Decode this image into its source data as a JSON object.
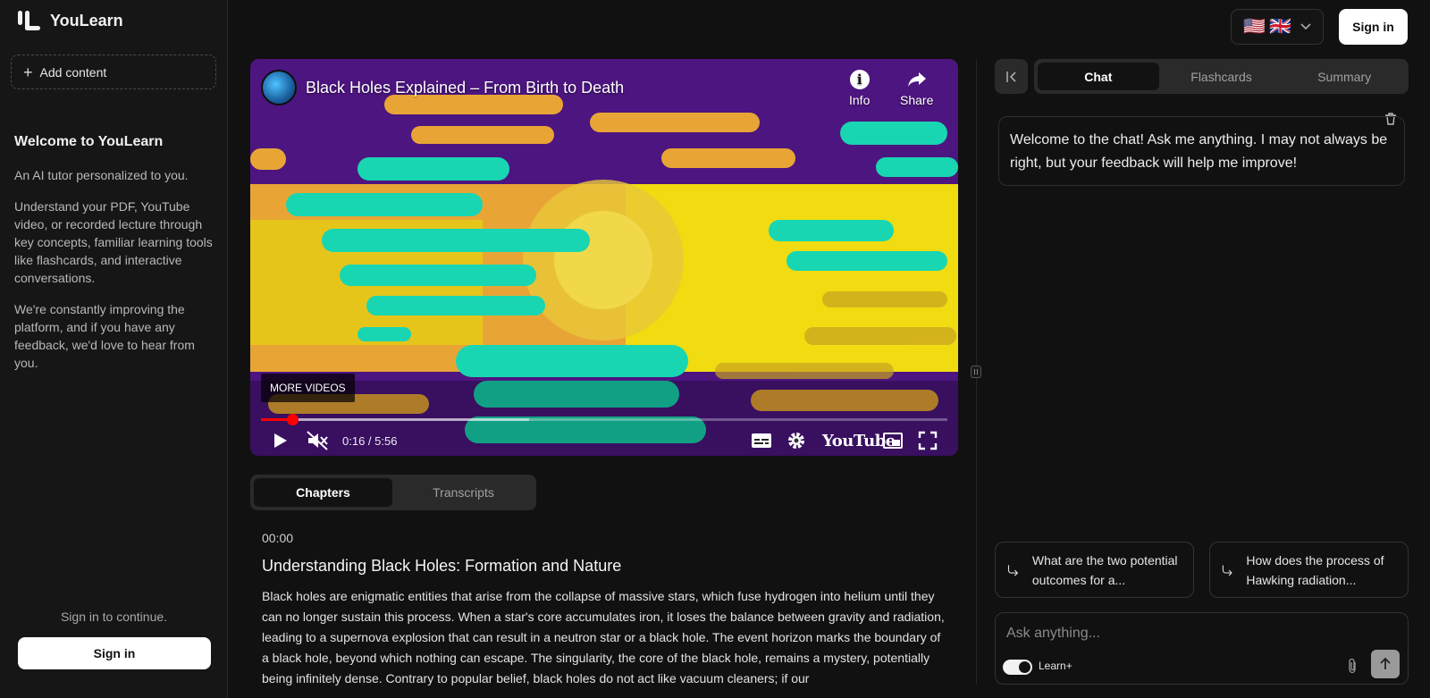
{
  "sidebar": {
    "logo_text": "YouLearn",
    "add_content_label": "Add content",
    "welcome_title": "Welcome to YouLearn",
    "welcome_paragraphs": [
      "An AI tutor personalized to you.",
      "Understand your PDF, YouTube video, or recorded lecture through key concepts, familiar learning tools like flashcards, and interactive conversations.",
      "We're constantly improving the platform, and if you have any feedback, we'd love to hear from you."
    ],
    "signin_note": "Sign in to continue.",
    "signin_label": "Sign in"
  },
  "topbar": {
    "flags": [
      "🇺🇸",
      "🇬🇧"
    ],
    "signin_label": "Sign in"
  },
  "video": {
    "title": "Black Holes Explained – From Birth to Death",
    "info_label": "Info",
    "share_label": "Share",
    "more_videos_label": "MORE VIDEOS",
    "time_display": "0:16 / 5:56",
    "played_fraction": 0.045,
    "buffered_fraction": 0.39,
    "youtube_label": "YouTube"
  },
  "content_tabs": [
    {
      "label": "Chapters",
      "active": true
    },
    {
      "label": "Transcripts",
      "active": false
    }
  ],
  "chapter": {
    "time": "00:00",
    "title": "Understanding Black Holes: Formation and Nature",
    "body": "Black holes are enigmatic entities that arise from the collapse of massive stars, which fuse hydrogen into helium until they can no longer sustain this process. When a star's core accumulates iron, it loses the balance between gravity and radiation, leading to a supernova explosion that can result in a neutron star or a black hole. The event horizon marks the boundary of a black hole, beyond which nothing can escape. The singularity, the core of the black hole, remains a mystery, potentially being infinitely dense. Contrary to popular belief, black holes do not act like vacuum cleaners; if our"
  },
  "chat_panel": {
    "tabs": [
      {
        "label": "Chat",
        "active": true
      },
      {
        "label": "Flashcards",
        "active": false
      },
      {
        "label": "Summary",
        "active": false
      }
    ],
    "welcome_message": "Welcome to the chat! Ask me anything. I may not always be right, but your feedback will help me improve!",
    "suggestions": [
      "What are the two potential outcomes for a...",
      "How does the process of Hawking radiation..."
    ],
    "input_placeholder": "Ask anything...",
    "learn_plus_label": "Learn+",
    "learn_plus_enabled": true
  },
  "colors": {
    "background": "#111111",
    "sidebar": "#161616",
    "progress": "#ff0000"
  }
}
